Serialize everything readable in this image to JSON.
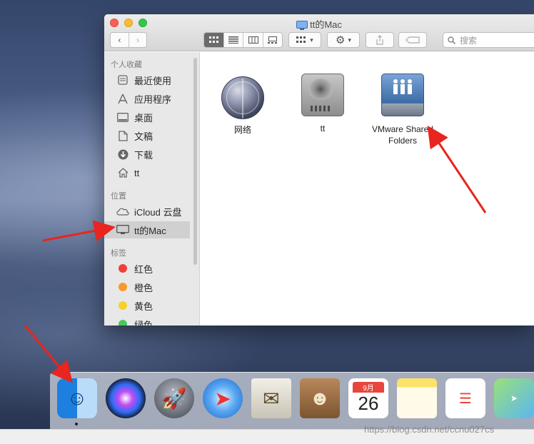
{
  "window": {
    "title": "tt的Mac",
    "search_placeholder": "搜索"
  },
  "sidebar": {
    "favorites_header": "个人收藏",
    "favorites": [
      {
        "label": "最近使用",
        "icon": "recents-icon"
      },
      {
        "label": "应用程序",
        "icon": "applications-icon"
      },
      {
        "label": "桌面",
        "icon": "desktop-icon"
      },
      {
        "label": "文稿",
        "icon": "documents-icon"
      },
      {
        "label": "下载",
        "icon": "downloads-icon"
      },
      {
        "label": "tt",
        "icon": "home-icon"
      }
    ],
    "locations_header": "位置",
    "locations": [
      {
        "label": "iCloud 云盘",
        "icon": "icloud-icon"
      },
      {
        "label": "tt的Mac",
        "icon": "computer-icon",
        "selected": true
      }
    ],
    "tags_header": "标签",
    "tags": [
      {
        "label": "红色",
        "color": "#f0403a"
      },
      {
        "label": "橙色",
        "color": "#f79a2c"
      },
      {
        "label": "黄色",
        "color": "#f5d22a"
      },
      {
        "label": "绿色",
        "color": "#4ac75a"
      }
    ]
  },
  "content": {
    "items": [
      {
        "label": "网络",
        "icon": "network-globe-icon"
      },
      {
        "label": "tt",
        "icon": "hard-disk-icon"
      },
      {
        "label": "VMware Shared Folders",
        "icon": "shared-folder-icon"
      }
    ]
  },
  "dock": {
    "calendar_month": "9月",
    "calendar_day": "26"
  },
  "watermark": "https://blog.csdn.net/ccnu027cs"
}
